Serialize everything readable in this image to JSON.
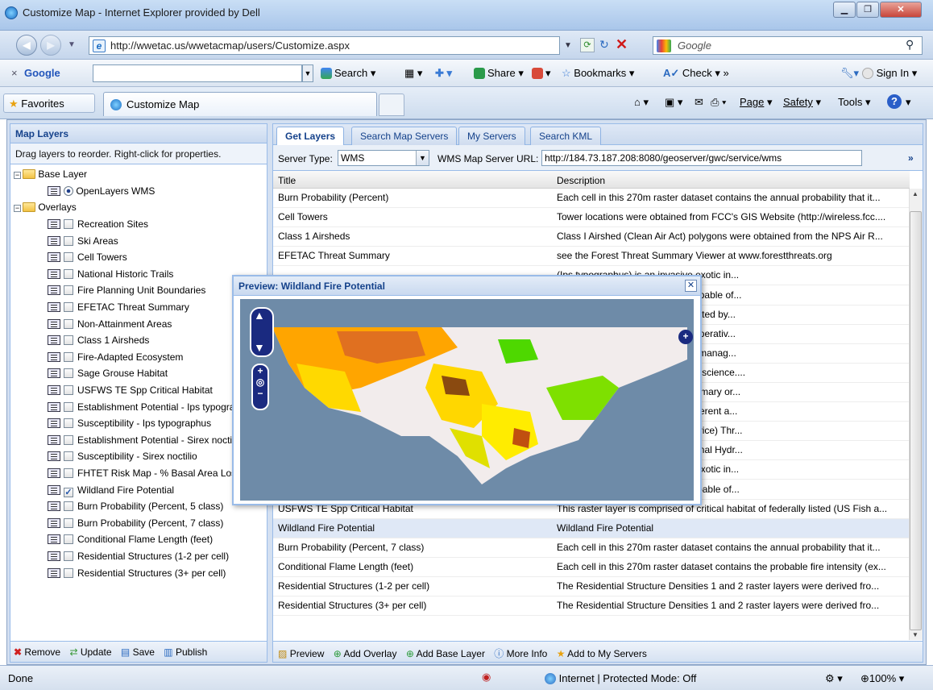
{
  "window": {
    "title": "Customize Map - Internet Explorer provided by Dell"
  },
  "address": {
    "url": "http://wwetac.us/wwetacmap/users/Customize.aspx",
    "search_placeholder": "Google"
  },
  "google_toolbar": {
    "logo": "Google",
    "items": [
      "Search",
      "Share",
      "Bookmarks",
      "Check",
      "Sign In"
    ]
  },
  "favbar": {
    "favorites": "Favorites",
    "tab_title": "Customize Map",
    "cmd_items": [
      "Page",
      "Safety",
      "Tools"
    ]
  },
  "left_panel": {
    "title": "Map Layers",
    "hint": "Drag layers to reorder. Right-click for properties.",
    "base_folder": "Base Layer",
    "base_layer": "OpenLayers WMS",
    "overlays_folder": "Overlays",
    "overlays": [
      {
        "label": "Recreation Sites",
        "checked": false
      },
      {
        "label": "Ski Areas",
        "checked": false
      },
      {
        "label": "Cell Towers",
        "checked": false
      },
      {
        "label": "National Historic Trails",
        "checked": false
      },
      {
        "label": "Fire Planning Unit Boundaries",
        "checked": false
      },
      {
        "label": "EFETAC Threat Summary",
        "checked": false
      },
      {
        "label": "Non-Attainment Areas",
        "checked": false
      },
      {
        "label": "Class 1 Airsheds",
        "checked": false
      },
      {
        "label": "Fire-Adapted Ecosystem",
        "checked": false
      },
      {
        "label": "Sage Grouse Habitat",
        "checked": false
      },
      {
        "label": "USFWS TE Spp Critical Habitat",
        "checked": false
      },
      {
        "label": "Establishment Potential - Ips typographus",
        "checked": false
      },
      {
        "label": "Susceptibility - Ips typographus",
        "checked": false
      },
      {
        "label": "Establishment Potential - Sirex noctilio",
        "checked": false
      },
      {
        "label": "Susceptibility - Sirex noctilio",
        "checked": false
      },
      {
        "label": "FHTET Risk Map - % Basal Area Loss",
        "checked": false
      },
      {
        "label": "Wildland Fire Potential",
        "checked": true
      },
      {
        "label": "Burn Probability (Percent, 5 class)",
        "checked": false
      },
      {
        "label": "Burn Probability (Percent, 7 class)",
        "checked": false
      },
      {
        "label": "Conditional Flame Length (feet)",
        "checked": false
      },
      {
        "label": "Residential Structures (1-2 per cell)",
        "checked": false
      },
      {
        "label": "Residential Structures (3+ per cell)",
        "checked": false
      }
    ],
    "buttons": [
      "Remove",
      "Update",
      "Save",
      "Publish"
    ]
  },
  "right_panel": {
    "tabs": [
      "Get Layers",
      "Search Map Servers",
      "My Servers",
      "Search KML"
    ],
    "server_type_label": "Server Type:",
    "server_type_value": "WMS",
    "url_label": "WMS Map Server URL:",
    "url_value": "http://184.73.187.208:8080/geoserver/gwc/service/wms",
    "columns": [
      "Title",
      "Description"
    ],
    "rows": [
      {
        "title": "Burn Probability (Percent)",
        "desc": "Each cell in this 270m raster dataset contains the annual probability that it...",
        "selected": false
      },
      {
        "title": "Cell Towers",
        "desc": "Tower locations were obtained from FCC's GIS Website (http://wireless.fcc....",
        "selected": false
      },
      {
        "title": "Class 1 Airsheds",
        "desc": "Class I Airshed (Clean Air Act) polygons were obtained from the NPS Air R...",
        "selected": false
      },
      {
        "title": "EFETAC Threat Summary",
        "desc": "see the Forest Threat Summary Viewer at www.forestthreats.org",
        "selected": false
      },
      {
        "title": "",
        "desc": "(Ips typographus) is an invasive exotic in...",
        "selected": false
      },
      {
        "title": "",
        "desc": "lio) is an invasive exotic insect capable of...",
        "selected": false
      },
      {
        "title": "",
        "desc": "e potential basal area loss calculated by...",
        "selected": false
      },
      {
        "title": "",
        "desc": "ional entity whose purpose is cooperativ...",
        "selected": false
      },
      {
        "title": "",
        "desc": "ependent ecosystems where the manag...",
        "selected": false
      },
      {
        "title": "",
        "desc": "d from the NPS Data Store (http://science....",
        "selected": false
      },
      {
        "title": "",
        "desc": "hat does not meet the national primary or...",
        "selected": false
      },
      {
        "title": "",
        "desc": "ed of five different layers from different a...",
        "selected": false
      },
      {
        "title": "",
        "desc": "y listed (US Fish and Wildlife Service) Thr...",
        "selected": false
      },
      {
        "title": "",
        "desc": "tained from the National Operational Hydr...",
        "selected": false
      },
      {
        "title": "",
        "desc": "(Ips typographus) is an invasive exotic in...",
        "selected": false
      },
      {
        "title": "",
        "desc": "io) is an invasive exotic insect capable of...",
        "selected": false
      },
      {
        "title": "USFWS TE Spp Critical Habitat",
        "desc": "This raster layer is comprised of critical habitat of federally listed (US Fish a...",
        "selected": false
      },
      {
        "title": "Wildland Fire Potential",
        "desc": "Wildland Fire Potential",
        "selected": true
      },
      {
        "title": "Burn Probability (Percent, 7 class)",
        "desc": "Each cell in this 270m raster dataset contains the annual probability that it...",
        "selected": false
      },
      {
        "title": "Conditional Flame Length (feet)",
        "desc": "Each cell in this 270m raster dataset contains the probable fire intensity (ex...",
        "selected": false
      },
      {
        "title": "Residential Structures (1-2 per cell)",
        "desc": "The Residential Structure Densities 1 and 2 raster layers were derived fro...",
        "selected": false
      },
      {
        "title": "Residential Structures (3+ per cell)",
        "desc": "The Residential Structure Densities 1 and 2 raster layers were derived fro...",
        "selected": false
      }
    ],
    "buttons": [
      "Preview",
      "Add Overlay",
      "Add Base Layer",
      "More Info",
      "Add to My Servers"
    ]
  },
  "preview": {
    "title": "Preview: Wildland Fire Potential"
  },
  "status": {
    "left": "Done",
    "zone": "Internet | Protected Mode: Off",
    "zoom": "100%"
  },
  "colors": {
    "panel_title": "#15428b",
    "selected_row": "#dfe8f6",
    "ocean": "#6e8ba8",
    "land": "#f2ecec"
  }
}
